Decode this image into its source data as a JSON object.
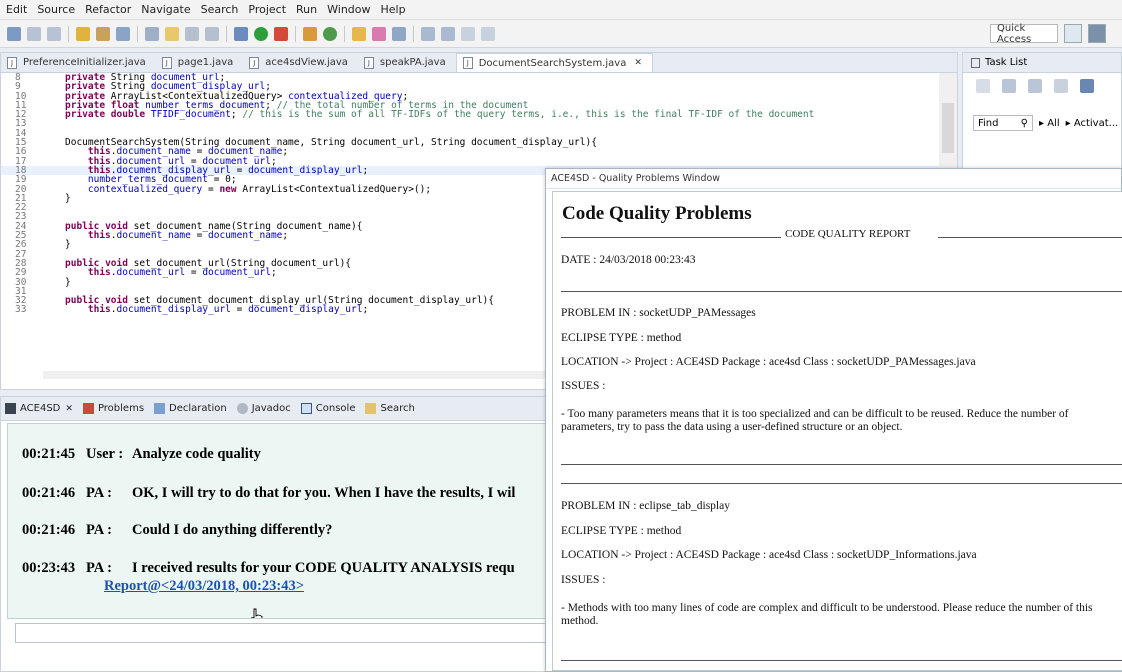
{
  "menu": [
    "Edit",
    "Source",
    "Refactor",
    "Navigate",
    "Search",
    "Project",
    "Run",
    "Window",
    "Help"
  ],
  "toolbar": {
    "quick_access": "Quick Access"
  },
  "editor": {
    "tabs": [
      "PreferenceInitializer.java",
      "page1.java",
      "ace4sdView.java",
      "speakPA.java",
      "DocumentSearchSystem.java"
    ],
    "line_numbers": [
      "8",
      "9",
      "10",
      "11",
      "12",
      "13",
      "14",
      "15",
      "16",
      "17",
      "18",
      "19",
      "20",
      "21",
      "22",
      "23",
      "24",
      "25",
      "26",
      "27",
      "28",
      "29",
      "30",
      "31",
      "32",
      "33"
    ],
    "lines": [
      "private String document_url;",
      "private String document_display_url;",
      "private ArrayList<ContextualizedQuery> contextualized_query;",
      "private float number_terms_document; // the total number of terms in the document",
      "private double TFIDF_document; // this is the sum of all TF-IDFs of the query terms, i.e., this is the final TF-IDF of the document",
      "",
      "",
      "DocumentSearchSystem(String document_name, String document_url, String document_display_url){",
      "    this.document_name = document_name;",
      "    this.document_url = document_url;",
      "    this.document_display_url = document_display_url;",
      "    number_terms_document = 0;",
      "    contextualized_query = new ArrayList<ContextualizedQuery>();",
      "}",
      "",
      "",
      "public void set_document_name(String document_name){",
      "    this.document_name = document_name;",
      "}",
      "",
      "public void set_document_url(String document_url){",
      "    this.document_url = document_url;",
      "}",
      "",
      "public void set_document_document_display_url(String document_display_url){",
      "    this.document_display_url = document_display_url;"
    ]
  },
  "tasklist": {
    "title": "Task List",
    "find": "Find",
    "all": "All",
    "activate": "Activat..."
  },
  "console": {
    "tabs": [
      "ACE4SD",
      "Problems",
      "Declaration",
      "Javadoc",
      "Console",
      "Search"
    ],
    "messages": [
      {
        "time": "00:21:45",
        "who": "User :",
        "text": "Analyze code quality"
      },
      {
        "time": "00:21:46",
        "who": "PA :",
        "text": "OK, I will try to do that for you. When I have the results, I wil"
      },
      {
        "time": "00:21:46",
        "who": "PA :",
        "text": "Could I do anything differently?"
      },
      {
        "time": "00:23:43",
        "who": "PA :",
        "text": "I received results for your CODE QUALITY ANALYSIS requ"
      }
    ],
    "report_link": "Report@<24/03/2018, 00:23:43>"
  },
  "quality": {
    "window_title": "ACE4SD - Quality Problems Window",
    "heading": "Code Quality Problems",
    "report_title": "CODE QUALITY REPORT",
    "date": "DATE : 24/03/2018  00:23:43",
    "problems": [
      {
        "problem": "PROBLEM IN : socketUDP_PAMessages",
        "type": "ECLIPSE TYPE : method",
        "location": "LOCATION -> Project : ACE4SD Package : ace4sd Class : socketUDP_PAMessages.java",
        "issues": "ISSUES :",
        "detail": "- Too many parameters means that it is too specialized and can be difficult to be reused. Reduce the number of parameters, try to pass the data using a user-defined structure or an object."
      },
      {
        "problem": "PROBLEM IN : eclipse_tab_display",
        "type": "ECLIPSE TYPE : method",
        "location": "LOCATION -> Project : ACE4SD Package : ace4sd Class : socketUDP_Informations.java",
        "issues": "ISSUES :",
        "detail": "- Methods with too many lines of code are complex and difficult to be understood. Please reduce the number of this method."
      }
    ]
  },
  "colors": {
    "link": "#1f4fb3",
    "chat_bg": "#ecf7f4",
    "keyword": "#7f0055",
    "field": "#0000c0",
    "comment": "#3f7f5f"
  }
}
